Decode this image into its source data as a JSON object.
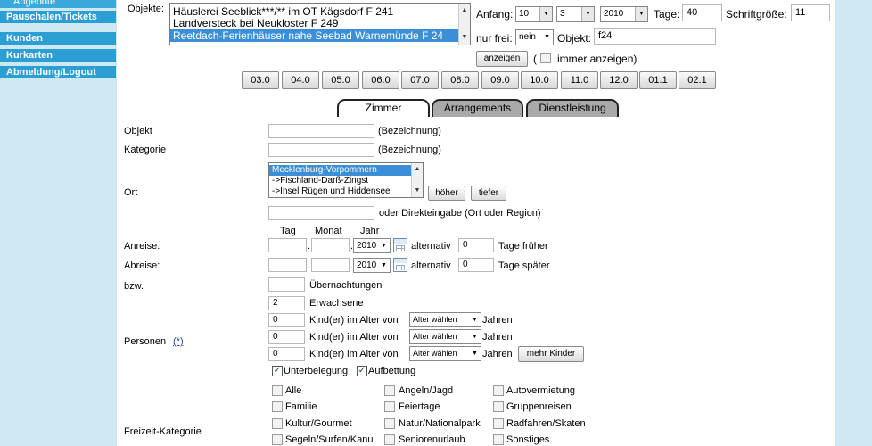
{
  "sidebar": {
    "items": [
      {
        "label": "Angebote"
      },
      {
        "label": "Pauschalen/Tickets"
      },
      {
        "label": "Kunden"
      },
      {
        "label": "Kurkarten"
      },
      {
        "label": "Abmeldung/Logout"
      }
    ]
  },
  "top": {
    "objekte_label": "Objekte:",
    "objects": [
      {
        "label": "Häuslerei Seeblick***/** im OT Kägsdorf F 241",
        "selected": false
      },
      {
        "label": "Landversteck bei Neukloster F 249",
        "selected": false
      },
      {
        "label": "Reetdach-Ferienhäuser nahe Seebad Warnemünde F 24",
        "selected": true
      }
    ],
    "anfang_label": "Anfang:",
    "anfang_day": "10",
    "anfang_month": "3",
    "anfang_year": "2010",
    "tage_label": "Tage:",
    "tage_value": "40",
    "schriftgroesse_label": "Schriftgröße:",
    "schriftgroesse_value": "11",
    "nur_frei_label": "nur frei:",
    "nur_frei_value": "nein",
    "objekt_label": "Objekt:",
    "objekt_value": "f24",
    "anzeigen_label": "anzeigen",
    "paren_open": "(",
    "immer_anzeigen_label": "immer anzeigen)"
  },
  "months": [
    "03.0",
    "04.0",
    "05.0",
    "06.0",
    "07.0",
    "08.0",
    "09.0",
    "10.0",
    "11.0",
    "12.0",
    "01.1",
    "02.1"
  ],
  "tabs": {
    "zimmer": "Zimmer",
    "arrangements": "Arrangements",
    "dienstleistung": "Dienstleistung"
  },
  "form": {
    "objekt_label": "Objekt",
    "objekt_hint": "(Bezeichnung)",
    "kategorie_label": "Kategorie",
    "kategorie_hint": "(Bezeichnung)",
    "ort_label": "Ort",
    "ort_options": [
      {
        "label": "Mecklenburg-Vorpommern",
        "selected": true
      },
      {
        "label": "->Fischland-Darß-Zingst",
        "selected": false
      },
      {
        "label": "->Insel Rügen und Hiddensee",
        "selected": false
      }
    ],
    "hoeher_label": "höher",
    "tiefer_label": "tiefer",
    "direkteingabe_hint": "oder Direkteingabe (Ort oder Region)",
    "tag_header": "Tag",
    "monat_header": "Monat",
    "jahr_header": "Jahr",
    "anreise_label": "Anreise:",
    "anreise_year": "2010",
    "anreise_alternativ_label": "alternativ",
    "anreise_alternativ_value": "0",
    "tage_frueher_label": "Tage früher",
    "abreise_label": "Abreise:",
    "abreise_year": "2010",
    "abreise_alternativ_label": "alternativ",
    "abreise_alternativ_value": "0",
    "tage_spaeter_label": "Tage später",
    "bzw_label": "bzw.",
    "uebernachtungen_label": "Übernachtungen",
    "personen_label": "Personen",
    "personen_link": "(*)",
    "erwachsene_value": "2",
    "erwachsene_label": "Erwachsene",
    "children": [
      {
        "count": "0",
        "label": "Kind(er) im Alter von",
        "select": "Alter wählen",
        "suffix": "Jahren"
      },
      {
        "count": "0",
        "label": "Kind(er) im Alter von",
        "select": "Alter wählen",
        "suffix": "Jahren"
      },
      {
        "count": "0",
        "label": "Kind(er) im Alter von",
        "select": "Alter wählen",
        "suffix": "Jahren"
      }
    ],
    "mehr_kinder_label": "mehr Kinder",
    "unterbelegung_label": "Unterbelegung",
    "aufbettung_label": "Aufbettung",
    "freizeit_label": "Freizeit-Kategorie",
    "freizeit": [
      [
        "Alle",
        "Angeln/Jagd",
        "Autovermietung"
      ],
      [
        "Familie",
        "Feiertage",
        "Gruppenreisen"
      ],
      [
        "Kultur/Gourmet",
        "Natur/Nationalpark",
        "Radfahren/Skaten"
      ],
      [
        "Segeln/Surfen/Kanu",
        "Seniorenurlaub",
        "Sonstiges"
      ]
    ]
  }
}
